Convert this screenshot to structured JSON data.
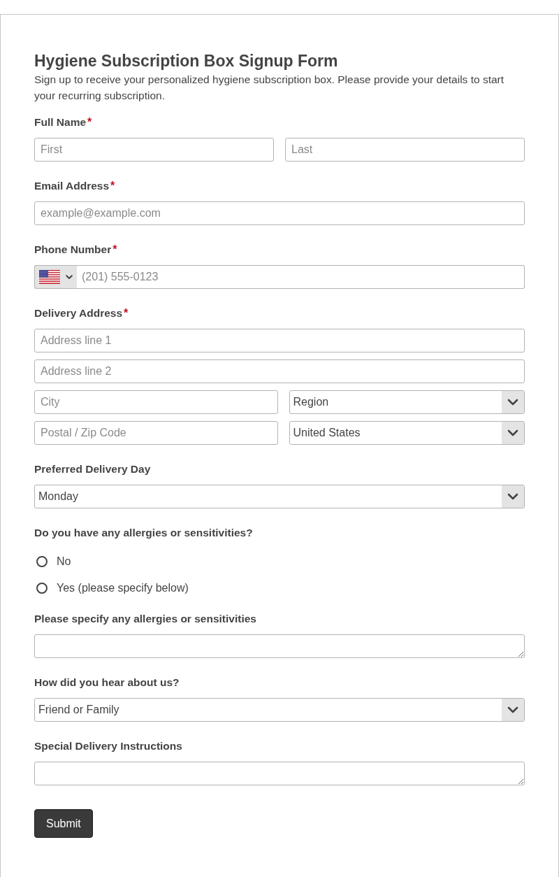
{
  "form": {
    "title": "Hygiene Subscription Box Signup Form",
    "description": "Sign up to receive your personalized hygiene subscription box. Please provide your details to start your recurring subscription."
  },
  "fields": [
    {
      "label": "Full Name",
      "required_mark": "*",
      "rows": [
        [
          {
            "kind": "text",
            "placeholder": "First"
          },
          {
            "kind": "text",
            "placeholder": "Last"
          }
        ]
      ]
    },
    {
      "label": "Email Address",
      "required_mark": "*",
      "rows": [
        [
          {
            "kind": "text",
            "placeholder": "example@example.com"
          }
        ]
      ]
    },
    {
      "label": "Phone Number",
      "required_mark": "*",
      "rows": [
        [
          {
            "kind": "phone",
            "placeholder": "(201) 555-0123"
          }
        ]
      ]
    },
    {
      "label": "Delivery Address",
      "required_mark": "*",
      "rows": [
        [
          {
            "kind": "text",
            "placeholder": "Address line 1"
          }
        ],
        [
          {
            "kind": "text",
            "placeholder": "Address line 2"
          }
        ],
        [
          {
            "kind": "text",
            "placeholder": "City"
          },
          {
            "kind": "select",
            "value": "Region"
          }
        ],
        [
          {
            "kind": "text",
            "placeholder": "Postal / Zip Code"
          },
          {
            "kind": "select",
            "value": "United States"
          }
        ]
      ]
    },
    {
      "label": "Preferred Delivery Day",
      "rows": [
        [
          {
            "kind": "select",
            "value": "Monday"
          }
        ]
      ]
    },
    {
      "label": "Do you have any allergies or sensitivities?",
      "rows": [
        [
          {
            "kind": "radio",
            "label": "No",
            "selected": false
          }
        ],
        [
          {
            "kind": "radio",
            "label": "Yes (please specify below)",
            "selected": false
          }
        ]
      ]
    },
    {
      "label": "Please specify any allergies or sensitivities",
      "rows": [
        [
          {
            "kind": "textarea"
          }
        ]
      ]
    },
    {
      "label": "How did you hear about us?",
      "rows": [
        [
          {
            "kind": "select",
            "value": "Friend or Family"
          }
        ]
      ]
    },
    {
      "label": "Special Delivery Instructions",
      "rows": [
        [
          {
            "kind": "textarea"
          }
        ]
      ]
    }
  ],
  "submit_button": {
    "label": "Submit"
  }
}
